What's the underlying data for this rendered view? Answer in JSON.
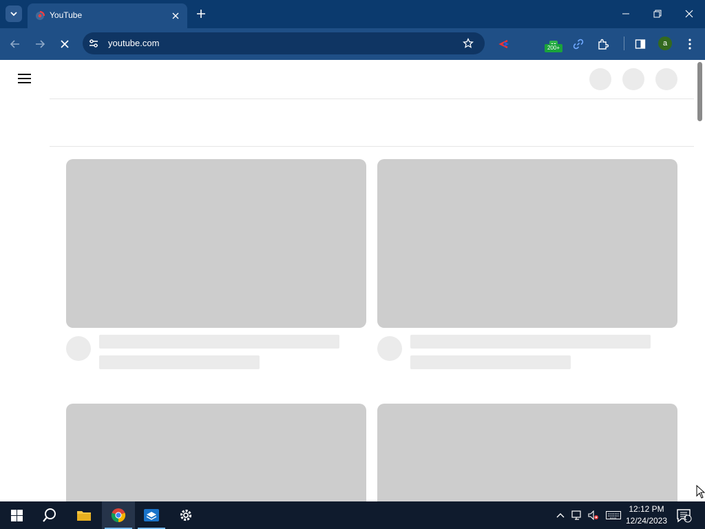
{
  "browser": {
    "tab": {
      "title": "YouTube"
    },
    "omnibox": {
      "url": "youtube.com"
    },
    "extensions": {
      "badge_count": "200+"
    },
    "profile": {
      "initial": "a"
    }
  },
  "taskbar": {
    "clock": {
      "time": "12:12 PM",
      "date": "12/24/2023"
    },
    "notifications": {
      "count": "1"
    }
  },
  "colors": {
    "chrome_frame": "#0b3a6e",
    "chrome_toolbar": "#1f4f86",
    "omnibox": "#0f3563",
    "skeleton": "#cdcdcd",
    "skeleton_light": "#ebebeb",
    "taskbar": "#0f1b2d",
    "youtube_red": "#ff0000"
  },
  "icons": {
    "tab_search": "chevron-down-icon",
    "favicon": "youtube-icon",
    "close_tab": "close-icon",
    "new_tab": "plus-icon",
    "back": "arrow-left-icon",
    "forward": "arrow-right-icon",
    "stop": "close-icon",
    "site_info": "tune-icon",
    "bookmark": "star-icon",
    "extensions": "puzzle-icon",
    "side_panel": "side-panel-icon",
    "menu": "kebab-icon",
    "start": "windows-icon",
    "search": "search-icon"
  }
}
